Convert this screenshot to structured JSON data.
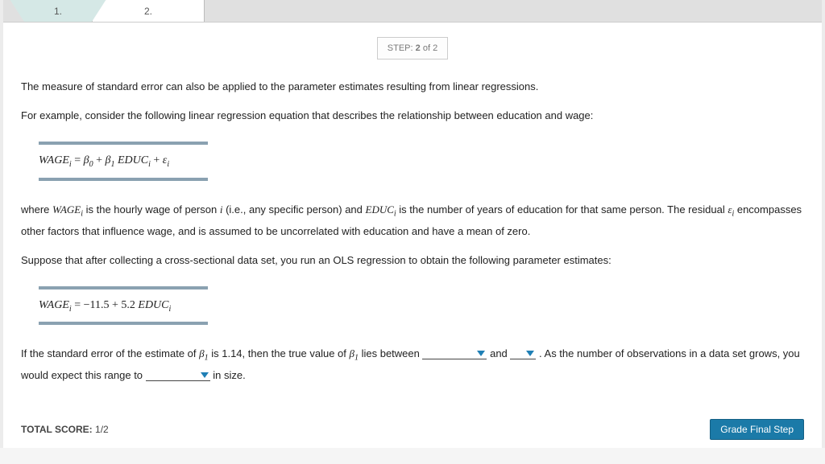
{
  "tabs": {
    "tab1_label": "1.",
    "tab2_label": "2."
  },
  "step": {
    "prefix": "STEP:",
    "current": "2",
    "of_word": "of",
    "total": "2"
  },
  "text": {
    "intro1": "The measure of standard error can also be applied to the parameter estimates resulting from linear regressions.",
    "intro2": "For example, consider the following linear regression equation that describes the relationship between education and wage:",
    "desc_pre_wage": "where ",
    "desc_wage_var": "WAGE",
    "desc_sub_i": "i",
    "desc_mid1": " is the hourly wage of person ",
    "desc_i": "i",
    "desc_mid2": " (i.e., any specific person) and ",
    "desc_educ_var": "EDUC",
    "desc_mid3": " is the number of years of education for that same person. The residual ",
    "desc_eps_var": "ε",
    "desc_mid4": " encompasses other factors that influence wage, and is assumed to be uncorrelated with education and have a mean of zero.",
    "suppose": "Suppose that after collecting a cross-sectional data set, you run an OLS regression to obtain the following parameter estimates:",
    "q_pre": "If the standard error of the estimate of ",
    "q_beta1": "β",
    "q_beta1_sub": "1",
    "q_mid1": " is 1.14, then the true value of ",
    "q_mid2": " lies between ",
    "q_and": " and ",
    "q_mid3": " . As the number of observations in a data set grows, you would expect this range to ",
    "q_end": "   in size."
  },
  "equations": {
    "eq1_lhs": "WAGE",
    "eq1_eq": " = ",
    "eq1_b0": "β",
    "eq1_b0_sub": "0",
    "eq1_plus1": " + ",
    "eq1_b1": "β",
    "eq1_b1_sub": "1",
    "eq1_space": " ",
    "eq1_educ": "EDUC",
    "eq1_plus2": " + ",
    "eq1_eps": "ε",
    "eq2_lhs": "WAGE",
    "eq2_eq": " = ",
    "eq2_c1": "−11.5",
    "eq2_plus": " + ",
    "eq2_c2": "5.2 ",
    "eq2_educ": "EDUC"
  },
  "footer": {
    "total_label": "TOTAL SCORE:",
    "total_value": "1/2",
    "grade_button": "Grade Final Step"
  }
}
